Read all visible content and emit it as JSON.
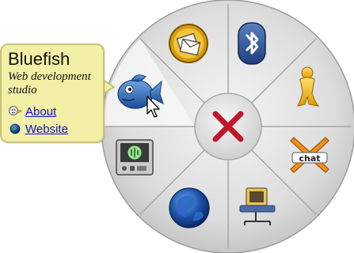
{
  "tooltip": {
    "title": "Bluefish",
    "description": "Web development studio",
    "links": [
      {
        "label": "About",
        "icon": "about-icon"
      },
      {
        "label": "Website",
        "icon": "globe-icon"
      }
    ]
  },
  "pie_menu": {
    "center": {
      "icon": "close-icon"
    },
    "items": [
      {
        "name": "Bluefish",
        "icon": "bluefish-icon",
        "hovered": true
      },
      {
        "name": "mail",
        "icon": "mail-icon"
      },
      {
        "name": "bluetooth",
        "icon": "bluetooth-icon"
      },
      {
        "name": "aim",
        "icon": "aim-icon"
      },
      {
        "name": "xchat",
        "icon": "xchat-icon",
        "caption": "chat"
      },
      {
        "name": "network",
        "icon": "network-icon"
      },
      {
        "name": "firefox",
        "icon": "firefox-icon"
      },
      {
        "name": "mixer",
        "icon": "mixer-icon"
      }
    ]
  },
  "colors": {
    "tooltip_bg": "#f3efa6",
    "link": "#1010c8",
    "close_red": "#c0182a"
  }
}
